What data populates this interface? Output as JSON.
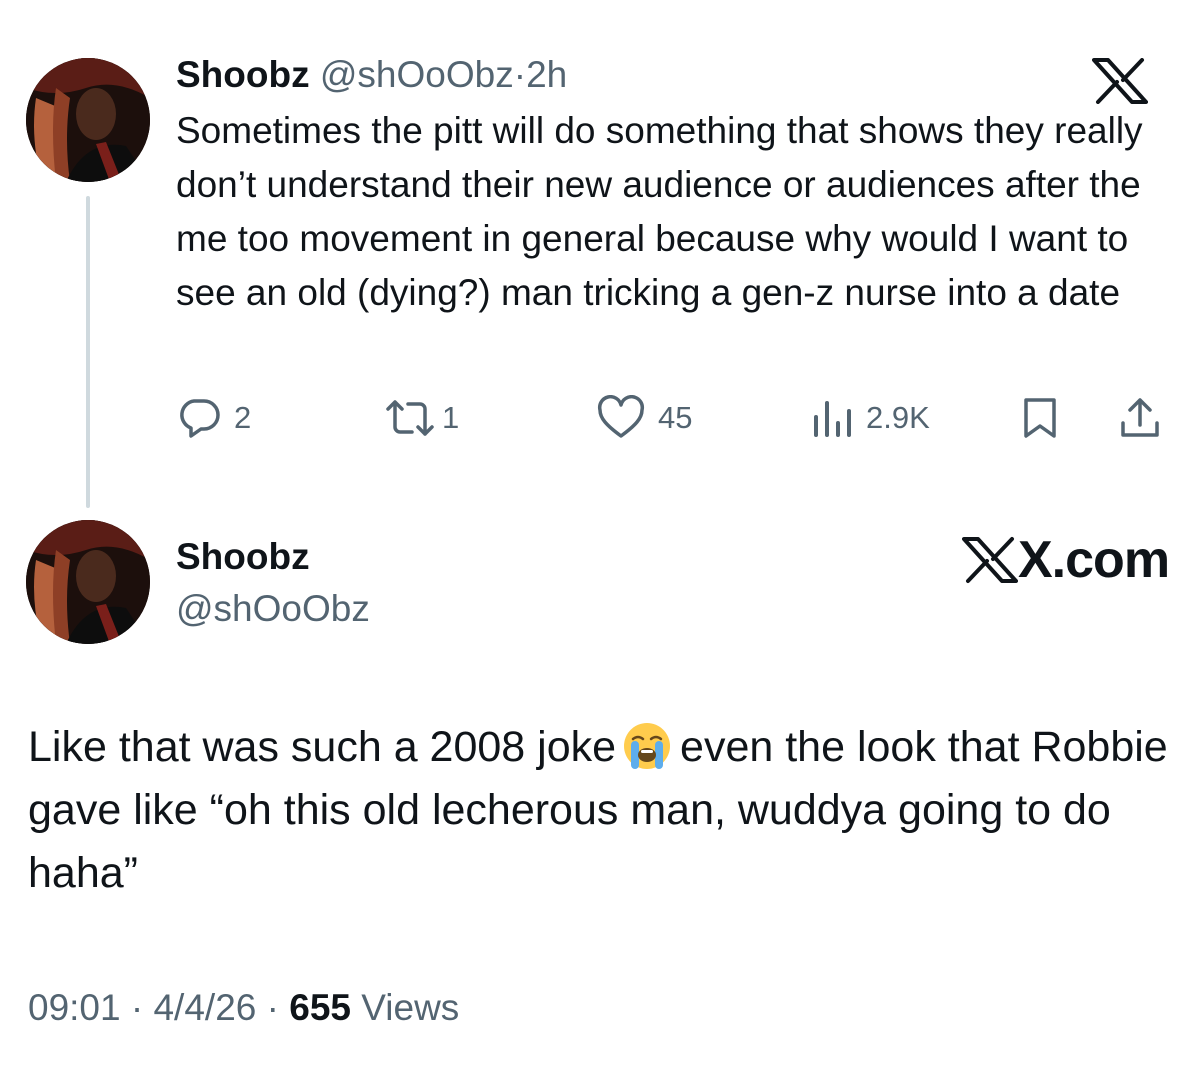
{
  "tweet": {
    "author_name": "Shoobz",
    "author_handle": "@shOoObz",
    "separator": "·",
    "time_ago": "2h",
    "text": "Sometimes the pitt will do something that shows they really don’t understand their new audience or audiences after the me too movement in general because why would I want to see an old (dying?) man tricking a gen-z nurse into a date",
    "actions": {
      "replies": "2",
      "reposts": "1",
      "likes": "45",
      "views": "2.9K"
    },
    "icons": [
      "reply-icon",
      "repost-icon",
      "like-icon",
      "views-icon",
      "bookmark-icon",
      "share-icon"
    ]
  },
  "reply": {
    "author_name": "Shoobz",
    "author_handle": "@shOoObz",
    "brand": "X.com",
    "text_before_emoji": "Like that was such a 2008 joke",
    "emoji": "loudly-crying-face-emoji",
    "text_after_emoji": "even the look that Robbie gave like “oh this old lecherous man, wuddya going to do haha”",
    "time": "09:01",
    "separator": "·",
    "date": "4/4/26",
    "views_count": "655",
    "views_label": "Views"
  },
  "colors": {
    "text_primary": "#0f1419",
    "text_secondary": "#536471",
    "thread_line": "#cfd9de",
    "background": "#ffffff"
  }
}
